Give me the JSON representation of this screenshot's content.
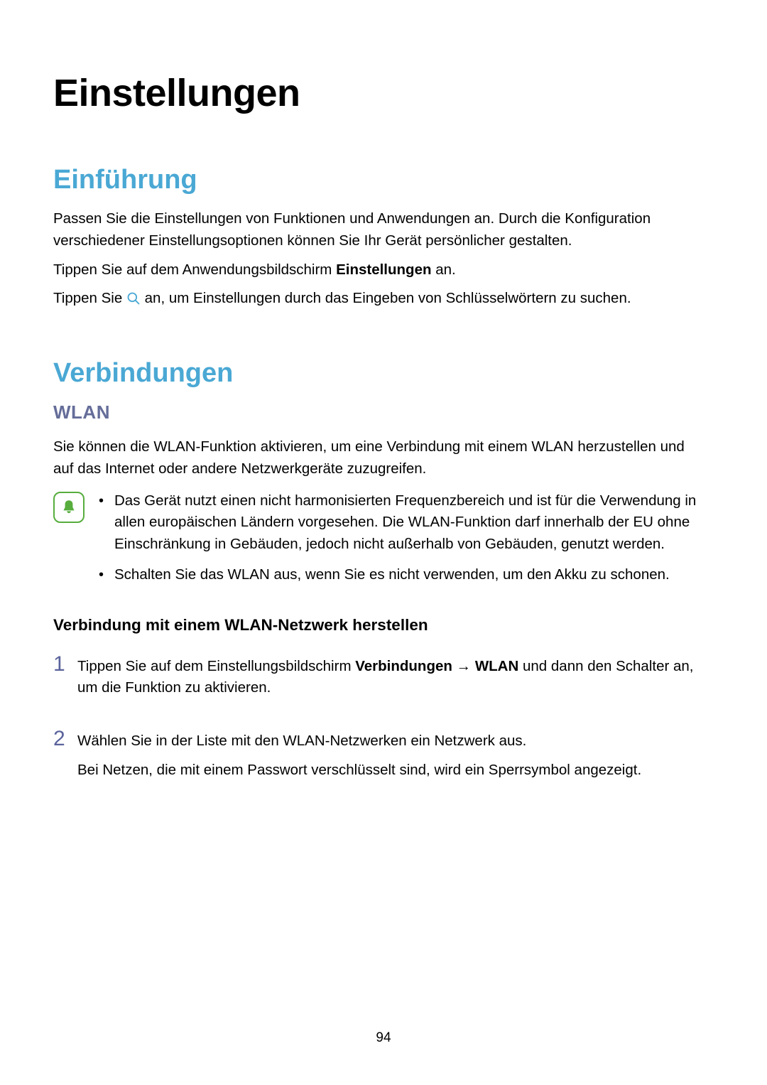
{
  "pageNumber": "94",
  "title": "Einstellungen",
  "section1": {
    "heading": "Einführung",
    "para1": "Passen Sie die Einstellungen von Funktionen und Anwendungen an. Durch die Konfiguration verschiedener Einstellungsoptionen können Sie Ihr Gerät persönlicher gestalten.",
    "para2_pre": "Tippen Sie auf dem Anwendungsbildschirm ",
    "para2_bold": "Einstellungen",
    "para2_post": " an.",
    "para3_pre": "Tippen Sie ",
    "para3_post": " an, um Einstellungen durch das Eingeben von Schlüsselwörtern zu suchen."
  },
  "section2": {
    "heading": "Verbindungen",
    "sub_heading": "WLAN",
    "para1": "Sie können die WLAN-Funktion aktivieren, um eine Verbindung mit einem WLAN herzustellen und auf das Internet oder andere Netzwerkgeräte zuzugreifen.",
    "info_bullet1": "Das Gerät nutzt einen nicht harmonisierten Frequenzbereich und ist für die Verwendung in allen europäischen Ländern vorgesehen. Die WLAN-Funktion darf innerhalb der EU ohne Einschränkung in Gebäuden, jedoch nicht außerhalb von Gebäuden, genutzt werden.",
    "info_bullet2": "Schalten Sie das WLAN aus, wenn Sie es nicht verwenden, um den Akku zu schonen.",
    "sub_sub_heading": "Verbindung mit einem WLAN-Netzwerk herstellen",
    "steps": {
      "n1": "1",
      "n2": "2",
      "s1_pre": "Tippen Sie auf dem Einstellungsbildschirm ",
      "s1_b1": "Verbindungen",
      "s1_arrow": " → ",
      "s1_b2": "WLAN",
      "s1_post": " und dann den Schalter an, um die Funktion zu aktivieren.",
      "s2_line1": "Wählen Sie in der Liste mit den WLAN-Netzwerken ein Netzwerk aus.",
      "s2_line2": "Bei Netzen, die mit einem Passwort verschlüsselt sind, wird ein Sperrsymbol angezeigt."
    }
  }
}
